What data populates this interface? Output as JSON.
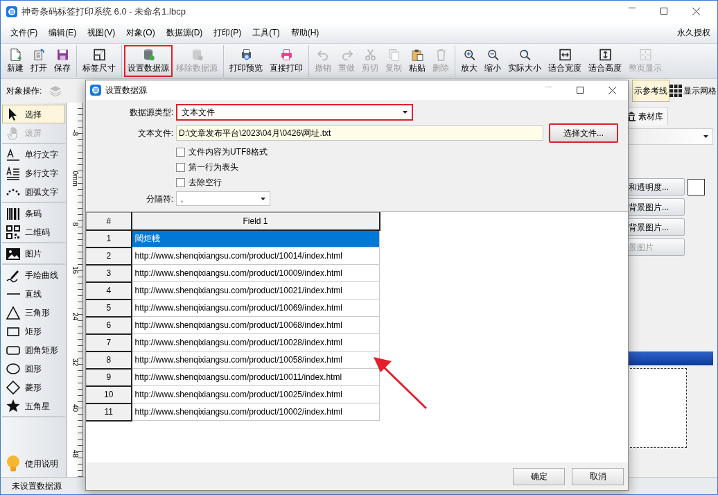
{
  "window": {
    "title": "神奇条码标签打印系统 6.0 - 未命名1.lbcp"
  },
  "menu": [
    {
      "label": "文件(F)"
    },
    {
      "label": "编辑(E)"
    },
    {
      "label": "视图(V)"
    },
    {
      "label": "对象(O)"
    },
    {
      "label": "数据源(D)"
    },
    {
      "label": "打印(P)"
    },
    {
      "label": "工具(T)"
    },
    {
      "label": "帮助(H)"
    }
  ],
  "license": "永久授权",
  "toolbar": [
    {
      "items": [
        {
          "kind": "new",
          "label": "新建",
          "disabled": false,
          "highlighted": false
        },
        {
          "kind": "open",
          "label": "打开",
          "disabled": false,
          "highlighted": false
        },
        {
          "kind": "save",
          "label": "保存",
          "disabled": false,
          "highlighted": false
        }
      ]
    },
    {
      "items": [
        {
          "kind": "labelsize",
          "label": "标签尺寸",
          "disabled": false,
          "highlighted": false
        }
      ]
    },
    {
      "items": [
        {
          "kind": "dbset",
          "label": "设置数据源",
          "disabled": false,
          "highlighted": true
        },
        {
          "kind": "dbremove",
          "label": "移除数据源",
          "disabled": true,
          "highlighted": false
        }
      ]
    },
    {
      "items": [
        {
          "kind": "preview",
          "label": "打印预览",
          "disabled": false,
          "highlighted": false
        },
        {
          "kind": "print",
          "label": "直接打印",
          "disabled": false,
          "highlighted": false
        }
      ]
    },
    {
      "items": [
        {
          "kind": "undo",
          "label": "撤销",
          "disabled": true,
          "highlighted": false
        },
        {
          "kind": "redo",
          "label": "重做",
          "disabled": true,
          "highlighted": false
        },
        {
          "kind": "cut",
          "label": "剪切",
          "disabled": true,
          "highlighted": false
        },
        {
          "kind": "copy",
          "label": "复制",
          "disabled": true,
          "highlighted": false
        },
        {
          "kind": "paste",
          "label": "粘贴",
          "disabled": false,
          "highlighted": false
        },
        {
          "kind": "delete",
          "label": "删除",
          "disabled": true,
          "highlighted": false
        }
      ]
    },
    {
      "items": [
        {
          "kind": "zoomin",
          "label": "放大",
          "disabled": false,
          "highlighted": false
        },
        {
          "kind": "zoomout",
          "label": "缩小",
          "disabled": false,
          "highlighted": false
        },
        {
          "kind": "actual",
          "label": "实际大小",
          "disabled": false,
          "highlighted": false
        },
        {
          "kind": "fitwidth",
          "label": "适合宽度",
          "disabled": false,
          "highlighted": false
        },
        {
          "kind": "fitheight",
          "label": "适合高度",
          "disabled": false,
          "highlighted": false
        },
        {
          "kind": "fitpage",
          "label": "整页显示",
          "disabled": true,
          "highlighted": false
        }
      ]
    }
  ],
  "object_bar": {
    "label": "对象操作:",
    "guides_tab": "示参考线",
    "grid_toggle": "显示网格"
  },
  "tools": [
    {
      "items": [
        {
          "kind": "pointer",
          "label": "选择",
          "selected": true,
          "disabled": false
        },
        {
          "kind": "hand",
          "label": "滚屏",
          "selected": false,
          "disabled": true
        }
      ]
    },
    {
      "items": [
        {
          "kind": "text",
          "label": "单行文字",
          "selected": false,
          "disabled": false
        },
        {
          "kind": "multitext",
          "label": "多行文字",
          "selected": false,
          "disabled": false
        },
        {
          "kind": "arctext",
          "label": "圆弧文字",
          "selected": false,
          "disabled": false
        }
      ]
    },
    {
      "items": [
        {
          "kind": "barcode",
          "label": "条码",
          "selected": false,
          "disabled": false
        },
        {
          "kind": "qrcode",
          "label": "二维码",
          "selected": false,
          "disabled": false
        }
      ]
    },
    {
      "items": [
        {
          "kind": "image",
          "label": "图片",
          "selected": false,
          "disabled": false
        }
      ]
    },
    {
      "items": [
        {
          "kind": "pen",
          "label": "手绘曲线",
          "selected": false,
          "disabled": false
        },
        {
          "kind": "line",
          "label": "直线",
          "selected": false,
          "disabled": false
        },
        {
          "kind": "triangle",
          "label": "三角形",
          "selected": false,
          "disabled": false
        },
        {
          "kind": "rect",
          "label": "矩形",
          "selected": false,
          "disabled": false
        },
        {
          "kind": "roundrect",
          "label": "圆角矩形",
          "selected": false,
          "disabled": false
        },
        {
          "kind": "ellipse",
          "label": "圆形",
          "selected": false,
          "disabled": false
        },
        {
          "kind": "diamond",
          "label": "菱形",
          "selected": false,
          "disabled": false
        },
        {
          "kind": "star",
          "label": "五角星",
          "selected": false,
          "disabled": false
        }
      ]
    }
  ],
  "help": {
    "label": "使用说明"
  },
  "ruler": {
    "labels": [
      "-8",
      "0mm",
      "8",
      "16",
      "24",
      "32",
      "40",
      "48"
    ]
  },
  "right_panel": {
    "tab": "素材库",
    "buttons": [
      {
        "label": "和透明度...",
        "disabled": false
      },
      {
        "label": "背景图片...",
        "disabled": false
      },
      {
        "label": "背景图片...",
        "disabled": false
      },
      {
        "label": "景图片",
        "disabled": true
      }
    ]
  },
  "status_bar": {
    "datasource": "未设置数据源"
  },
  "dialog": {
    "title": "设置数据源",
    "type_label": "数据源类型:",
    "type_value": "文本文件",
    "type_highlighted": true,
    "file_label": "文本文件:",
    "file_value": "D:\\文章发布平台\\2023\\04月\\0426\\网址.txt",
    "choose_button": {
      "label": "选择文件...",
      "highlighted": true
    },
    "options": [
      {
        "label": "文件内容为UTF8格式",
        "checked": false
      },
      {
        "label": "第一行为表头",
        "checked": false
      },
      {
        "label": "去除空行",
        "checked": false
      }
    ],
    "separator_label": "分隔符:",
    "separator_value": ",",
    "table": {
      "columns": [
        "#",
        "Field 1"
      ],
      "rows": [
        {
          "cells": [
            "1",
            "閾炬帴"
          ],
          "selected": true
        },
        {
          "cells": [
            "2",
            "http://www.shenqixiangsu.com/product/10014/index.html"
          ],
          "selected": false
        },
        {
          "cells": [
            "3",
            "http://www.shenqixiangsu.com/product/10009/index.html"
          ],
          "selected": false
        },
        {
          "cells": [
            "4",
            "http://www.shenqixiangsu.com/product/10021/index.html"
          ],
          "selected": false
        },
        {
          "cells": [
            "5",
            "http://www.shenqixiangsu.com/product/10069/index.html"
          ],
          "selected": false
        },
        {
          "cells": [
            "6",
            "http://www.shenqixiangsu.com/product/10068/index.html"
          ],
          "selected": false
        },
        {
          "cells": [
            "7",
            "http://www.shenqixiangsu.com/product/10028/index.html"
          ],
          "selected": false
        },
        {
          "cells": [
            "8",
            "http://www.shenqixiangsu.com/product/10058/index.html"
          ],
          "selected": false
        },
        {
          "cells": [
            "9",
            "http://www.shenqixiangsu.com/product/10011/index.html"
          ],
          "selected": false
        },
        {
          "cells": [
            "10",
            "http://www.shenqixiangsu.com/product/10025/index.html"
          ],
          "selected": false
        },
        {
          "cells": [
            "11",
            "http://www.shenqixiangsu.com/product/10002/index.html"
          ],
          "selected": false
        }
      ]
    },
    "buttons": [
      "确定",
      "取消"
    ]
  },
  "annotations": [
    {
      "kind": "arrow"
    }
  ]
}
